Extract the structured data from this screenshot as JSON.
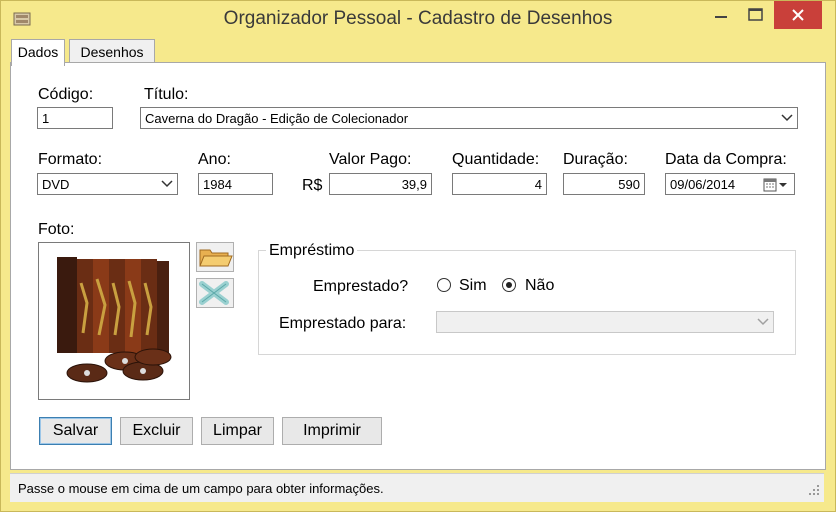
{
  "window": {
    "title": "Organizador Pessoal - Cadastro de Desenhos"
  },
  "tabs": [
    {
      "label": "Dados",
      "active": true
    },
    {
      "label": "Desenhos",
      "active": false
    }
  ],
  "fields": {
    "codigo": {
      "label": "Código:",
      "value": "1"
    },
    "titulo": {
      "label": "Título:",
      "value": "Caverna do Dragão - Edição de Colecionador"
    },
    "formato": {
      "label": "Formato:",
      "value": "DVD"
    },
    "ano": {
      "label": "Ano:",
      "value": "1984"
    },
    "valor_pago": {
      "label": "Valor Pago:",
      "prefix": "R$",
      "value": "39,9"
    },
    "quantidade": {
      "label": "Quantidade:",
      "value": "4"
    },
    "duracao": {
      "label": "Duração:",
      "value": "590"
    },
    "data_compra": {
      "label": "Data da Compra:",
      "value": "09/06/2014"
    },
    "foto": {
      "label": "Foto:"
    }
  },
  "emprestimo": {
    "title": "Empréstimo",
    "emprestado_label": "Emprestado?",
    "options": [
      {
        "label": "Sim",
        "selected": false
      },
      {
        "label": "Não",
        "selected": true
      }
    ],
    "emprestado_para_label": "Emprestado para:",
    "emprestado_para_value": ""
  },
  "buttons": {
    "salvar": "Salvar",
    "excluir": "Excluir",
    "limpar": "Limpar",
    "imprimir": "Imprimir"
  },
  "status": {
    "text": "Passe o mouse em cima de um campo para obter informações."
  },
  "colors": {
    "titlebar_bg": "#f6e98c",
    "close_button": "#c9403a",
    "panel_bg": "#ffffff"
  }
}
